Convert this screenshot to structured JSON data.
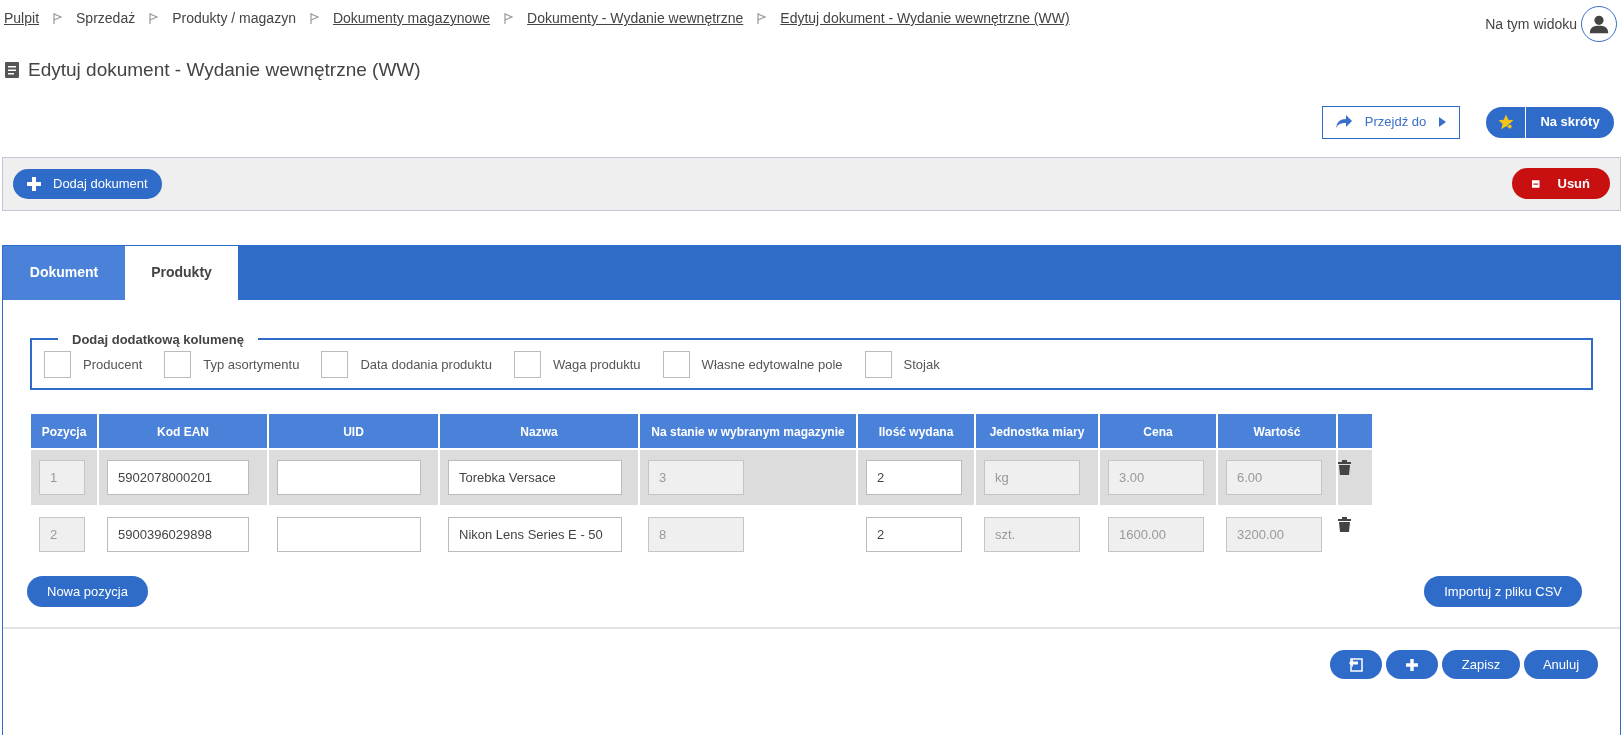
{
  "breadcrumbs": [
    {
      "label": "Pulpit",
      "link": true
    },
    {
      "label": "Sprzedaż",
      "link": false
    },
    {
      "label": "Produkty / magazyn",
      "link": false
    },
    {
      "label": "Dokumenty magazynowe",
      "link": true
    },
    {
      "label": "Dokumenty - Wydanie wewnętrzne",
      "link": true
    },
    {
      "label": "Edytuj dokument - Wydanie wewnętrzne (WW)",
      "link": true
    }
  ],
  "user_menu": {
    "label": "Na tym widoku"
  },
  "page_title": "Edytuj dokument - Wydanie wewnętrzne (WW)",
  "header_buttons": {
    "goto": "Przejdź do",
    "shortcuts": "Na skróty"
  },
  "toolbar": {
    "add": "Dodaj dokument",
    "delete": "Usuń"
  },
  "tabs": [
    {
      "label": "Dokument",
      "selected": false
    },
    {
      "label": "Produkty",
      "selected": true
    }
  ],
  "extra_columns": {
    "legend": "Dodaj dodatkową kolumenę",
    "options": [
      {
        "label": "Producent",
        "checked": false
      },
      {
        "label": "Typ asortymentu",
        "checked": false
      },
      {
        "label": "Data dodania produktu",
        "checked": false
      },
      {
        "label": "Waga produktu",
        "checked": false
      },
      {
        "label": "Własne edytowalne pole",
        "checked": false
      },
      {
        "label": "Stojak",
        "checked": false
      }
    ]
  },
  "table": {
    "columns": [
      {
        "label": "Pozycja",
        "editable": false
      },
      {
        "label": "Kod EAN",
        "editable": true
      },
      {
        "label": "UID",
        "editable": true
      },
      {
        "label": "Nazwa",
        "editable": true
      },
      {
        "label": "Na stanie w wybranym magazynie",
        "editable": false
      },
      {
        "label": "Ilość wydana",
        "editable": true
      },
      {
        "label": "Jednostka miary",
        "editable": false
      },
      {
        "label": "Cena",
        "editable": false
      },
      {
        "label": "Wartość",
        "editable": false
      }
    ],
    "rows": [
      {
        "selected": true,
        "cells": [
          "1",
          "5902078000201",
          "",
          "Torebka Versace",
          "3",
          "2",
          "kg",
          "3.00",
          "6.00"
        ]
      },
      {
        "selected": false,
        "cells": [
          "2",
          "5900396029898",
          "",
          "Nikon Lens Series E - 50",
          "8",
          "2",
          "szt.",
          "1600.00",
          "3200.00"
        ]
      }
    ]
  },
  "table_buttons": {
    "new_row": "Nowa pozycja",
    "import": "Importuj z pliku CSV"
  },
  "footer_buttons": {
    "save": "Zapisz",
    "cancel": "Anuluj"
  }
}
